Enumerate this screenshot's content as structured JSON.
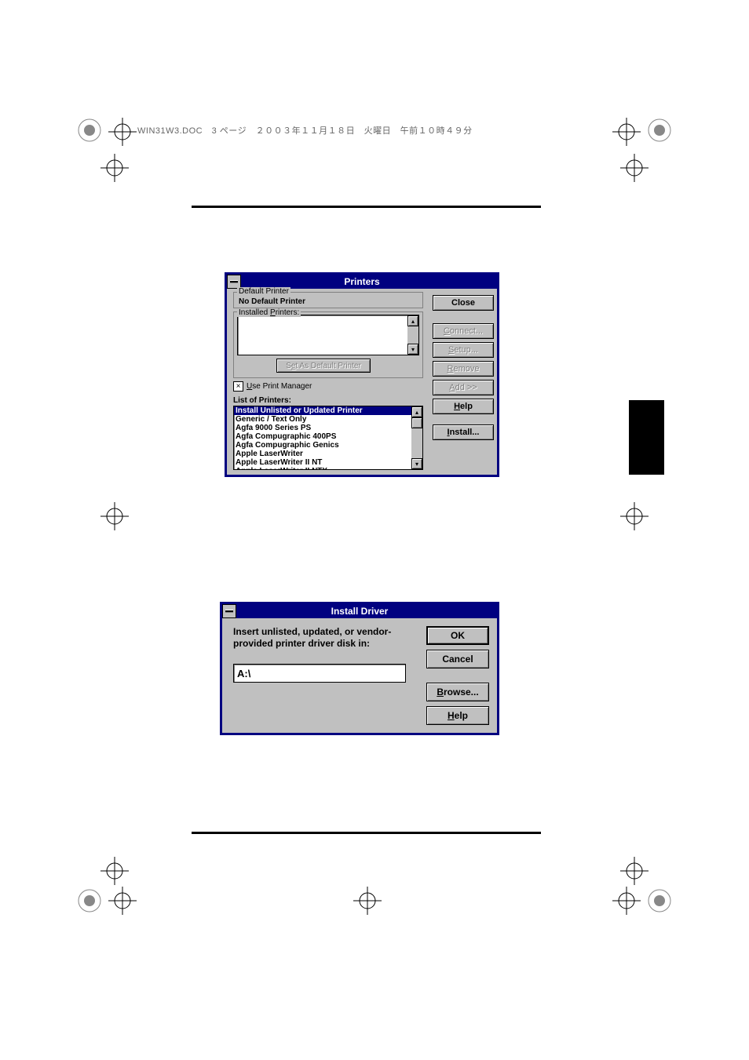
{
  "page_header": "WIN31W3.DOC　3 ページ　２００３年１１月１８日　火曜日　午前１０時４９分",
  "printers_dialog": {
    "title": "Printers",
    "default_printer_label": "Default Printer",
    "default_printer_value": "No Default Printer",
    "installed_label": "Installed Printers:",
    "set_default_btn": "Set As Default Printer",
    "use_print_manager_label": "Use Print Manager",
    "use_print_manager_checked": true,
    "list_of_printers_label": "List of Printers:",
    "printer_list": [
      "Install Unlisted or Updated Printer",
      "Generic / Text Only",
      "Agfa 9000 Series PS",
      "Agfa Compugraphic 400PS",
      "Agfa Compugraphic Genics",
      "Apple LaserWriter",
      "Apple LaserWriter II NT",
      "Apple LaserWriter II NTX"
    ],
    "selected_index": 0,
    "buttons": {
      "close": "Close",
      "connect": "Connect...",
      "setup": "Setup...",
      "remove": "Remove",
      "add": "Add >>",
      "help": "Help",
      "install": "Install..."
    }
  },
  "install_driver_dialog": {
    "title": "Install Driver",
    "instruction": "Insert unlisted, updated, or vendor-provided printer driver disk in:",
    "path_value": "A:\\",
    "buttons": {
      "ok": "OK",
      "cancel": "Cancel",
      "browse": "Browse...",
      "help": "Help"
    }
  }
}
